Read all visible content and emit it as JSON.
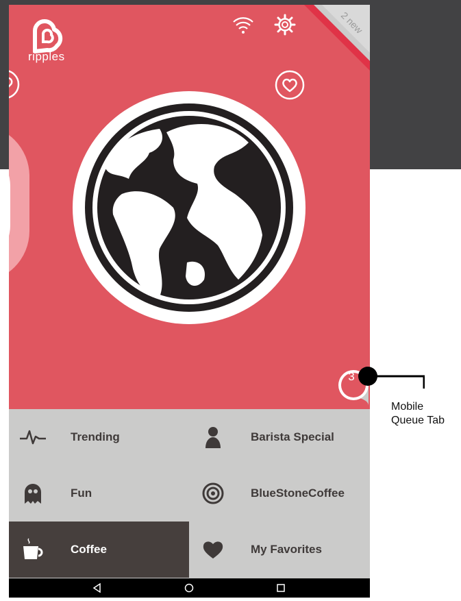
{
  "app": {
    "name": "ripples"
  },
  "header": {
    "new_badge": "2 new"
  },
  "queue": {
    "count": "3"
  },
  "menu": {
    "items": [
      {
        "label": "Trending",
        "icon": "pulse-icon"
      },
      {
        "label": "Barista Special",
        "icon": "person-icon"
      },
      {
        "label": "Fun",
        "icon": "ghost-icon"
      },
      {
        "label": "BlueStoneCoffee",
        "icon": "target-icon"
      },
      {
        "label": "Coffee",
        "icon": "coffee-cup-icon",
        "active": true
      },
      {
        "label": "My Favorites",
        "icon": "heart-icon"
      }
    ]
  },
  "annotation": {
    "line1": "Mobile",
    "line2": "Queue Tab"
  },
  "colors": {
    "hero": "#e05660",
    "menu_bg": "#cbcbca",
    "active_item": "#463f3d",
    "backdrop": "#424244"
  }
}
